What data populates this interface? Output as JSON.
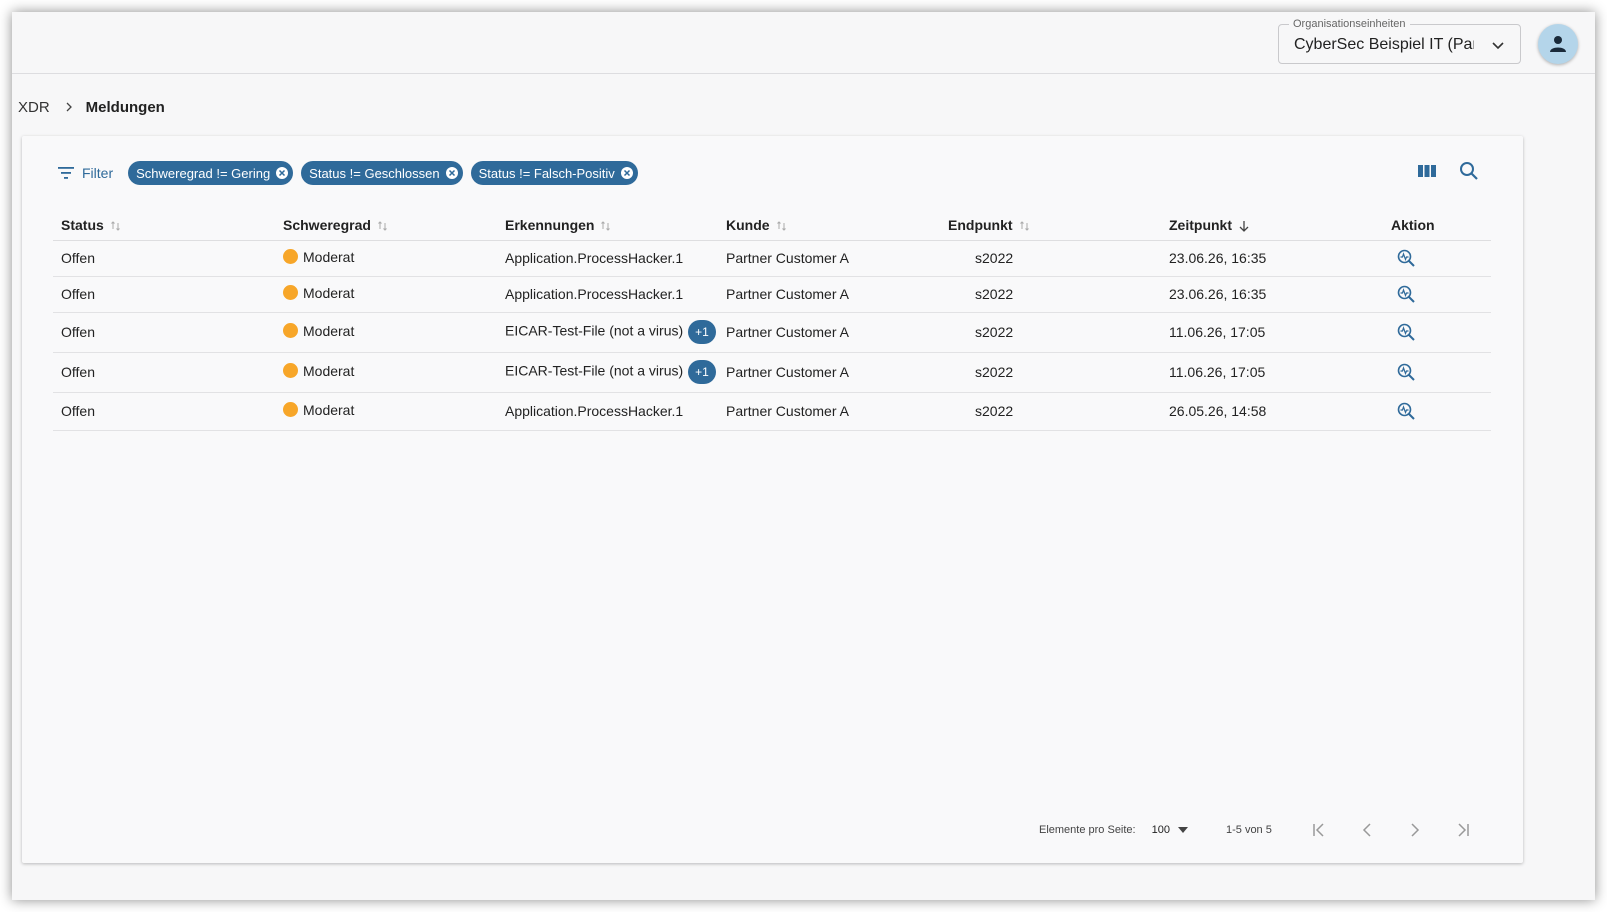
{
  "header": {
    "org_label": "Organisationseinheiten",
    "org_value": "CyberSec Beispiel IT (Partner)"
  },
  "breadcrumb": {
    "root": "XDR",
    "current": "Meldungen"
  },
  "toolbar": {
    "filter_label": "Filter",
    "chips": [
      "Schweregrad != Gering",
      "Status != Geschlossen",
      "Status != Falsch-Positiv"
    ]
  },
  "table": {
    "columns": [
      "Status",
      "Schweregrad",
      "Erkennungen",
      "Kunde",
      "Endpunkt",
      "Zeitpunkt",
      "Aktion"
    ],
    "rows": [
      {
        "status": "Offen",
        "severity": "Moderat",
        "detection": "Application.ProcessHacker.1",
        "extra": "",
        "customer": "Partner Customer A",
        "endpoint": "s2022",
        "time": "23.06.26, 16:35"
      },
      {
        "status": "Offen",
        "severity": "Moderat",
        "detection": "Application.ProcessHacker.1",
        "extra": "",
        "customer": "Partner Customer A",
        "endpoint": "s2022",
        "time": "23.06.26, 16:35"
      },
      {
        "status": "Offen",
        "severity": "Moderat",
        "detection": "EICAR-Test-File (not a virus)",
        "extra": "+1",
        "customer": "Partner Customer A",
        "endpoint": "s2022",
        "time": "11.06.26, 17:05"
      },
      {
        "status": "Offen",
        "severity": "Moderat",
        "detection": "EICAR-Test-File (not a virus)",
        "extra": "+1",
        "customer": "Partner Customer A",
        "endpoint": "s2022",
        "time": "11.06.26, 17:05"
      },
      {
        "status": "Offen",
        "severity": "Moderat",
        "detection": "Application.ProcessHacker.1",
        "extra": "",
        "customer": "Partner Customer A",
        "endpoint": "s2022",
        "time": "26.05.26, 14:58"
      }
    ]
  },
  "pager": {
    "per_page_label": "Elemente pro Seite:",
    "per_page_value": "100",
    "range": "1-5 von 5"
  },
  "colors": {
    "accent": "#2f6a9a",
    "severity_moderate": "#f7a629",
    "avatar_bg": "#b4d5ea"
  }
}
